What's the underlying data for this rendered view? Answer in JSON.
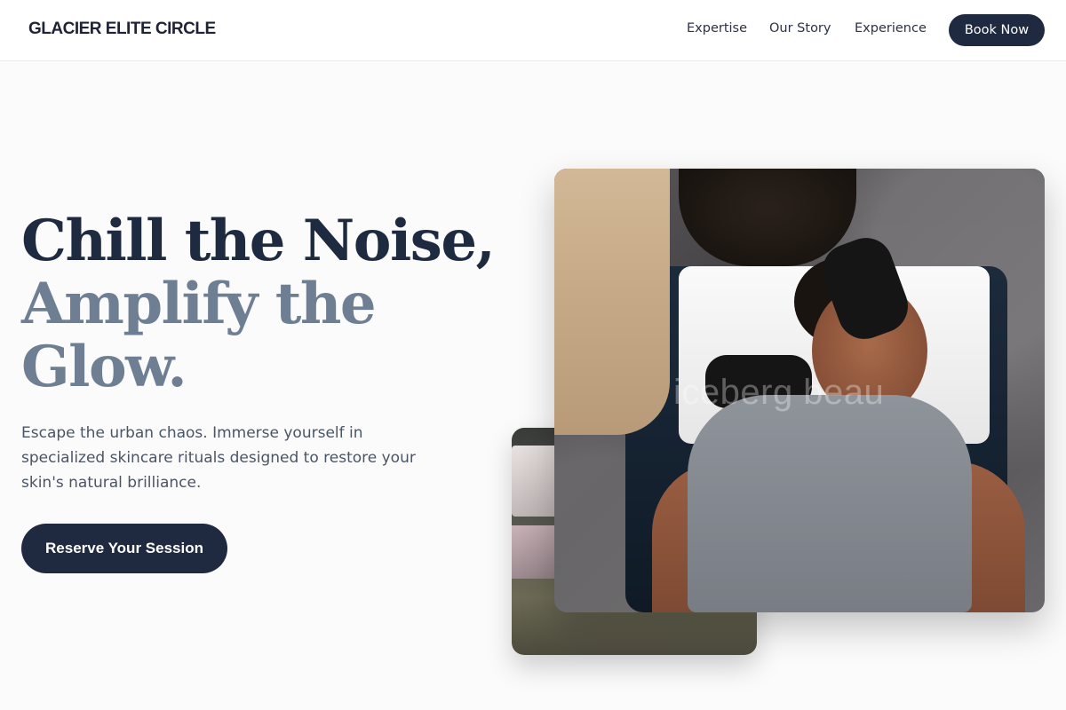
{
  "header": {
    "logo": "GLACIER ELITE CIRCLE",
    "nav": [
      "Expertise",
      "Our Story",
      "Experience"
    ],
    "cta": "Book Now"
  },
  "hero": {
    "headline_line1": "Chill the Noise,",
    "headline_line2": "Amplify the",
    "headline_line3": "Glow.",
    "subtext": "Escape the urban chaos. Immerse yourself in specialized skincare rituals designed to restore your skin's natural brilliance.",
    "cta": "Reserve Your Session",
    "image_watermark": "iceberg beau"
  },
  "colors": {
    "primary": "#1f2940",
    "headline_dark": "#1e2a3f",
    "headline_muted": "#6e7f94",
    "background": "#fbfbfb"
  }
}
